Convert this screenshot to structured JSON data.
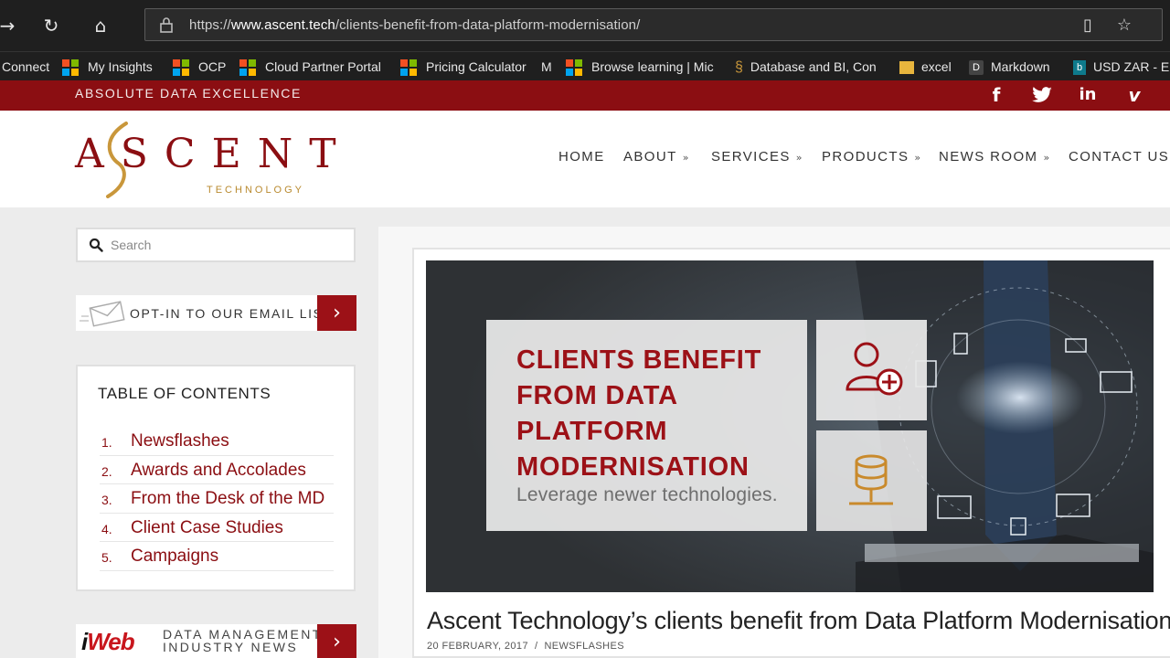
{
  "browser": {
    "url_prefix": "https://",
    "url_domain": "www.ascent.tech",
    "url_path": "/clients-benefit-from-data-platform-modernisation/",
    "bookmarks": [
      {
        "label": "Connect"
      },
      {
        "label": "My Insights"
      },
      {
        "label": "OCP"
      },
      {
        "label": "Cloud Partner Portal"
      },
      {
        "label": "Pricing Calculator"
      },
      {
        "label": "M"
      },
      {
        "label": "Browse learning | Mic"
      },
      {
        "label": "Database and BI, Con"
      },
      {
        "label": "excel"
      },
      {
        "label": "Markdown"
      },
      {
        "label": "USD ZAR - E"
      }
    ]
  },
  "site": {
    "tagline": "ABSOLUTE DATA EXCELLENCE",
    "logo_main": "ASCENT",
    "logo_sub": "TECHNOLOGY",
    "social": [
      "f",
      "t",
      "in",
      "v"
    ],
    "nav": [
      {
        "label": "HOME"
      },
      {
        "label": "ABOUT"
      },
      {
        "label": "SERVICES"
      },
      {
        "label": "PRODUCTS"
      },
      {
        "label": "NEWS ROOM"
      },
      {
        "label": "CONTACT US"
      }
    ],
    "accent_color": "#8b0e12"
  },
  "sidebar": {
    "search_placeholder": "Search",
    "optin_label": "OPT-IN TO OUR EMAIL LIST",
    "toc_title": "TABLE OF CONTENTS",
    "toc_items": [
      {
        "num": "1.",
        "label": "Newsflashes"
      },
      {
        "num": "2.",
        "label": "Awards and Accolades"
      },
      {
        "num": "3.",
        "label": "From the Desk of the MD"
      },
      {
        "num": "4.",
        "label": "Client Case Studies"
      },
      {
        "num": "5.",
        "label": "Campaigns"
      }
    ],
    "itweb_brand_i": "i",
    "itweb_brand": "Web",
    "itweb_line1": "DATA MANAGEMENT",
    "itweb_line2": "INDUSTRY NEWS"
  },
  "post": {
    "hero_line1": "CLIENTS BENEFIT",
    "hero_line2": "FROM DATA",
    "hero_line3": "PLATFORM",
    "hero_line4": "MODERNISATION",
    "hero_sub": "Leverage newer technologies.",
    "title": "Ascent Technology’s clients benefit from Data Platform Modernisation",
    "date": "20 FEBRUARY, 2017",
    "separator": "/",
    "category": "NEWSFLASHES"
  }
}
